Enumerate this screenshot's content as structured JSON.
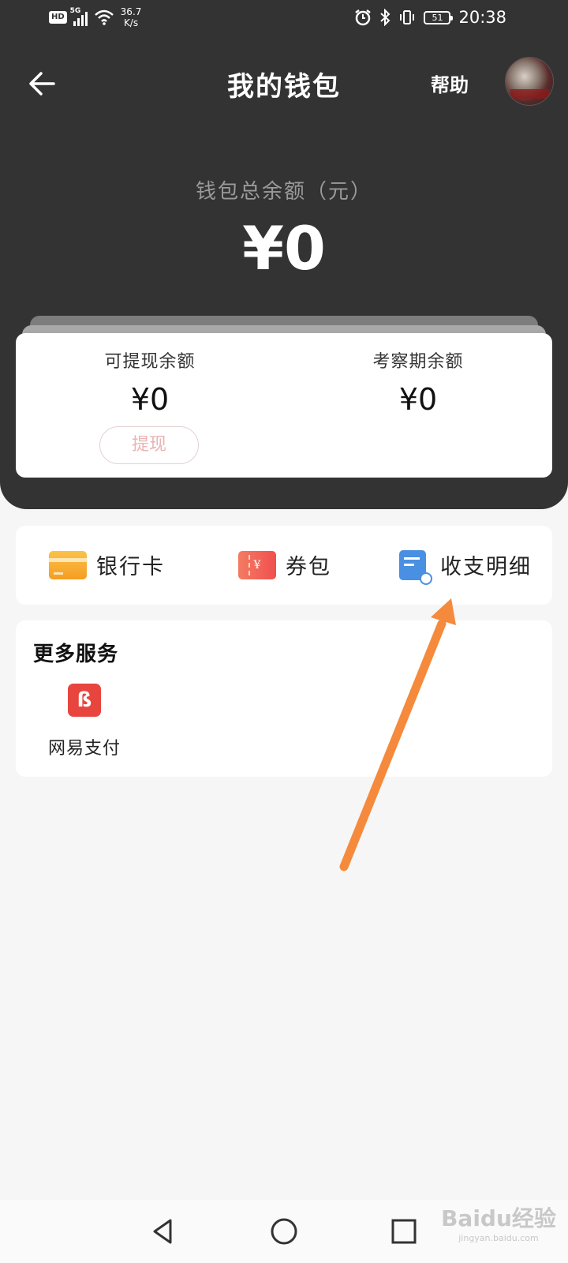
{
  "status_bar": {
    "hd": "HD",
    "network": "5G",
    "speed_value": "36.7",
    "speed_unit": "K/s",
    "battery": "51",
    "time": "20:38"
  },
  "nav": {
    "title": "我的钱包",
    "help_label": "帮助"
  },
  "summary": {
    "total_label": "钱包总余额（元）",
    "total_value": "¥0"
  },
  "balances": {
    "withdrawable_label": "可提现余额",
    "withdrawable_value": "¥0",
    "probation_label": "考察期余额",
    "probation_value": "¥0",
    "withdraw_button": "提现"
  },
  "quick_actions": [
    {
      "label": "银行卡",
      "icon": "bank-card-icon"
    },
    {
      "label": "券包",
      "icon": "coupon-icon",
      "glyph": "¥"
    },
    {
      "label": "收支明细",
      "icon": "transaction-detail-icon"
    }
  ],
  "more_services": {
    "title": "更多服务",
    "items": [
      {
        "label": "网易支付",
        "icon": "netease-pay-icon",
        "glyph": "ß"
      }
    ]
  },
  "watermark": {
    "brand": "Baidu经验",
    "url": "jingyan.baidu.com"
  },
  "colors": {
    "header_bg": "#333333",
    "page_bg": "#f6f6f6",
    "annotation_arrow": "#f58a3c",
    "withdraw_text": "#eab3b3",
    "pay_red": "#e8453f",
    "detail_blue": "#4a90e2"
  }
}
